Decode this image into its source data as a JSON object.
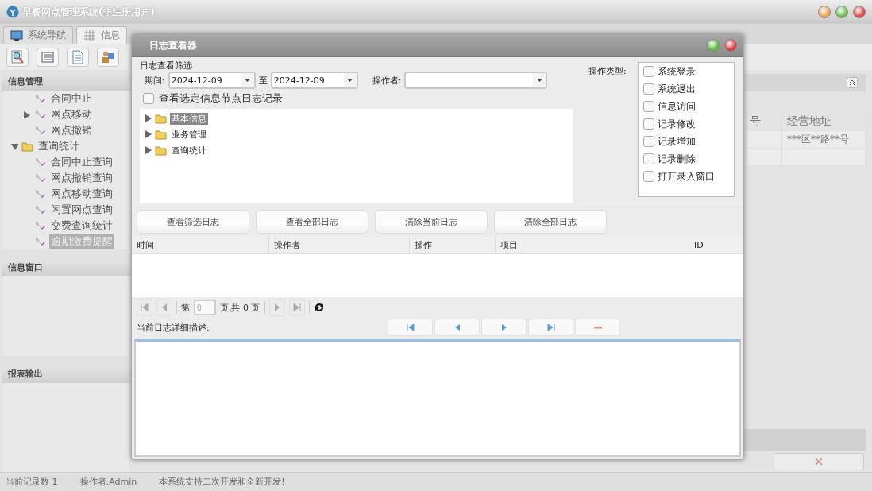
{
  "window": {
    "title": "早餐网点管理系统(非注册用户)"
  },
  "tabs": [
    {
      "label": "系统导航",
      "kind": "monitor",
      "selected": false
    },
    {
      "label": "信息",
      "kind": "grid",
      "selected": true
    }
  ],
  "toolbar": [
    {
      "kind": "search"
    },
    {
      "kind": "list"
    },
    {
      "kind": "doc"
    },
    {
      "kind": "user"
    }
  ],
  "sidebar": {
    "sections": [
      {
        "title": "信息管理",
        "tree": [
          {
            "children": [
              {
                "label": "合同中止",
                "selected": false
              },
              {
                "label": "网点移动",
                "expanded": false,
                "selected": false
              },
              {
                "label": "网点撤销",
                "selected": false
              }
            ]
          },
          {
            "label": "查询统计",
            "expanded": true,
            "selected": false,
            "children": [
              {
                "label": "合同中止查询",
                "selected": false
              },
              {
                "label": "网点撤销查询",
                "selected": false
              },
              {
                "label": "网点移动查询",
                "selected": false
              },
              {
                "label": "闲置网点查询",
                "selected": false
              },
              {
                "label": "交费查询统计",
                "selected": false
              },
              {
                "label": "逾期缴费提醒",
                "selected": true
              }
            ]
          }
        ]
      },
      {
        "title": "信息窗口"
      },
      {
        "title": "报表输出"
      }
    ]
  },
  "main_table": {
    "columns": [
      "号",
      "经营地址"
    ],
    "rows": [
      {
        "business_address": "***区**路**号"
      }
    ]
  },
  "dialog": {
    "title": "日志查看器",
    "filter": {
      "title": "日志查看筛选",
      "period_label": "期间:",
      "date_from": "2024-12-09",
      "to_label": "至",
      "date_to": "2024-12-09",
      "operator_label": "操作者:",
      "op_type_label": "操作类型:",
      "op_types": [
        {
          "label": "系统登录",
          "checked": false
        },
        {
          "label": "系统退出",
          "checked": false
        },
        {
          "label": "信息访问",
          "checked": false
        },
        {
          "label": "记录修改",
          "checked": false
        },
        {
          "label": "记录增加",
          "checked": false
        },
        {
          "label": "记录删除",
          "checked": false
        },
        {
          "label": "打开录入窗口",
          "checked": false
        }
      ],
      "node_filter": {
        "label": "查看选定信息节点日志记录",
        "checked": false
      },
      "tree": [
        {
          "label": "基本信息",
          "expanded": false,
          "selected": true
        },
        {
          "label": "业务管理",
          "expanded": false,
          "selected": false
        },
        {
          "label": "查询统计",
          "expanded": false,
          "selected": false
        }
      ]
    },
    "buttons": [
      "查看筛选日志",
      "查看全部日志",
      "清除当前日志",
      "清除全部日志"
    ],
    "log_table": {
      "columns": [
        "时间",
        "操作者",
        "操作",
        "项目",
        "ID"
      ]
    },
    "pager": {
      "page_label": "第",
      "page": "0",
      "total_text": "页,共 0 页"
    },
    "detail_label": "当前日志详细描述:",
    "nav_buttons": [
      {
        "kind": "first"
      },
      {
        "kind": "prev"
      },
      {
        "kind": "next"
      },
      {
        "kind": "last"
      },
      {
        "kind": "remove"
      }
    ]
  },
  "status_bar": [
    "当前记录数 1",
    "操作者:Admin",
    "本系统支持二次开发和全新开发!"
  ]
}
